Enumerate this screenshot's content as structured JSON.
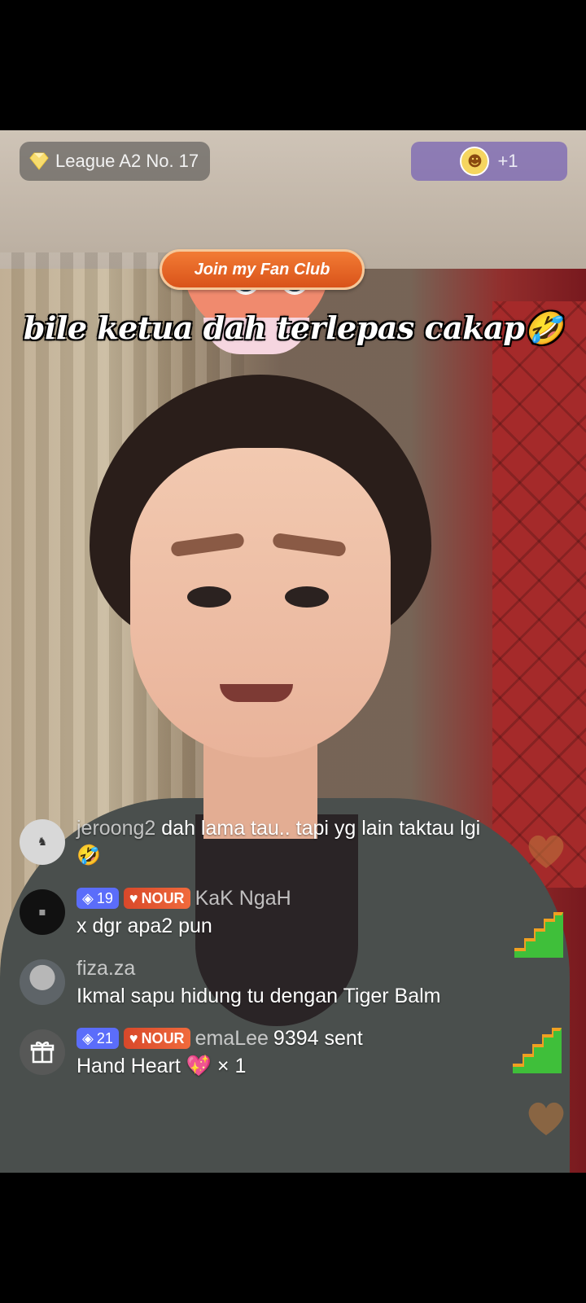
{
  "top_bar": {
    "league_label": "League A2 No. 17",
    "viewers_extra": "+1"
  },
  "fan_club": {
    "button_label": "Join my Fan Club"
  },
  "caption": "bile ketua dah terlepas cakap🤣",
  "chat": [
    {
      "username": "jeroong2",
      "message": "dah lama tau.. tapi yg lain taktau lgi",
      "emoji": "🤣"
    },
    {
      "level": "19",
      "badge": "NOUR",
      "username": "KaK NgaH",
      "message": "x dgr apa2 pun"
    },
    {
      "username": "fiza.za",
      "message": "Ikmal sapu hidung tu dengan Tiger Balm"
    },
    {
      "level": "21",
      "badge": "NOUR",
      "username": "emaLee",
      "username_tail": "9394 sent",
      "gift_name": "Hand Heart",
      "gift_emoji": "💖",
      "gift_count": "× 1"
    }
  ],
  "icons": {
    "league": "diamond-icon",
    "gift": "gift-icon",
    "level": "diamond-level-icon",
    "side": [
      "heart-icon",
      "stairs-icon"
    ]
  },
  "colors": {
    "fanclub_orange": "#e2622a",
    "level_badge_blue": "#5b6dfa",
    "viewers_purple": "#7864b4"
  }
}
